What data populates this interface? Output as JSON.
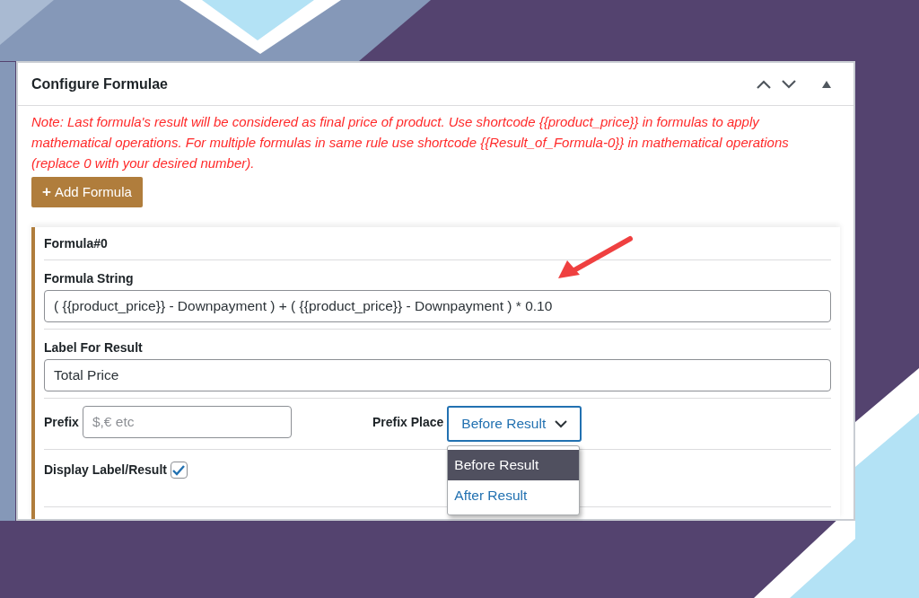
{
  "panel": {
    "title": "Configure Formulae",
    "note": "Note: Last formula's result will be considered as final price of product. Use shortcode {{product_price}} in formulas to apply mathematical operations. For multiple formulas in same rule use shortcode {{Result_of_Formula-0}} in mathematical operations (replace 0 with your desired number).",
    "add_button": {
      "icon": "+",
      "label": "Add Formula"
    }
  },
  "formula": {
    "title": "Formula#0",
    "formula_string": {
      "label": "Formula String",
      "value": "( {{product_price}} - Downpayment ) + ( {{product_price}} - Downpayment ) * 0.10"
    },
    "label_for_result": {
      "label": "Label For Result",
      "value": "Total Price"
    },
    "prefix": {
      "label": "Prefix",
      "placeholder": "$,€ etc"
    },
    "prefix_place": {
      "label": "Prefix Place",
      "value": "Before Result",
      "expanded": true,
      "options": [
        {
          "label": "Before Result",
          "selected": true
        },
        {
          "label": "After Result",
          "selected": false
        }
      ]
    },
    "display_label_result": {
      "label": "Display Label/Result",
      "checked": true
    }
  }
}
